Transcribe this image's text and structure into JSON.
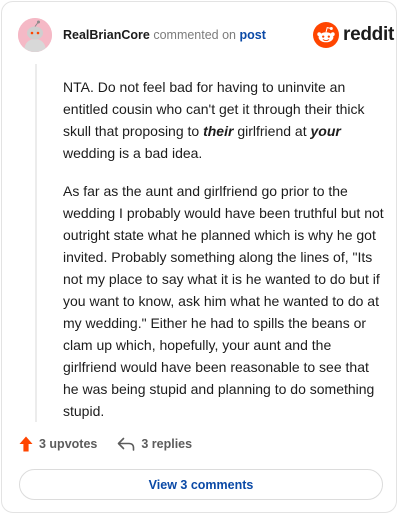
{
  "header": {
    "username": "RealBrianCore",
    "action_text": "commented on",
    "post_link": "post",
    "brand": "reddit"
  },
  "comment": {
    "p1": {
      "part1": "NTA. Do not feel bad for having to uninvite an entitled cousin who can't get it through their thick skull that proposing to ",
      "em1": "their",
      "part2": " girlfriend at ",
      "em2": "your",
      "part3": " wedding is a bad idea."
    },
    "p2": "As far as the aunt and girlfriend go prior to the wedding I probably would have been truthful but not outright state what he planned which is why he got invited. Probably something along the lines of, \"Its not my place to say what it is he wanted to do but if you want to know, ask him what he wanted to do at my wedding.\" Either he had to spills the beans or clam up which, hopefully, your aunt and the girlfriend would have been reasonable to see that he was being stupid and planning to do something stupid."
  },
  "actions": {
    "upvotes": "3 upvotes",
    "replies": "3 replies"
  },
  "view_comments_label": "View 3 comments",
  "colors": {
    "upvote": "#ff4500",
    "link": "#0a49a6",
    "avatar_bg": "#f5b9c6",
    "brand": "#ff4500"
  },
  "icons": {
    "avatar": "snoo-avatar",
    "brand": "reddit-snoo-logo-icon",
    "upvote": "upvote-arrow-icon",
    "reply": "reply-arrow-icon"
  }
}
